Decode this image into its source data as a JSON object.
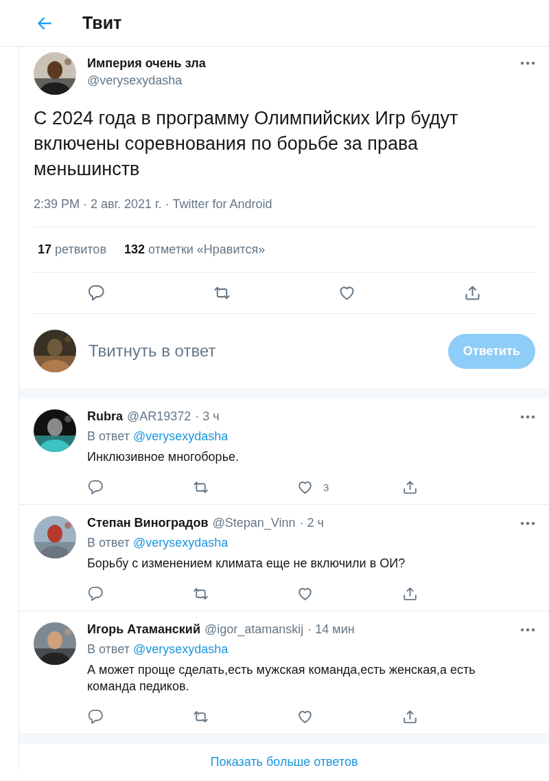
{
  "header": {
    "title": "Твит"
  },
  "tweet": {
    "author": {
      "name": "Империя очень зла",
      "handle": "@verysexydasha"
    },
    "text": "С 2024 года в программу Олимпийских Игр будут включены соревнования по борьбе за права меньшинств",
    "meta": "2:39 PM · 2 авг. 2021 г. · Twitter for Android",
    "stats": [
      {
        "count": "17",
        "label": "ретвитов"
      },
      {
        "count": "132",
        "label": "отметки «Нравится»"
      }
    ]
  },
  "compose": {
    "placeholder": "Твитнуть в ответ",
    "button": {
      "label": "Ответить",
      "disabled": true
    }
  },
  "replies": [
    {
      "name": "Rubra",
      "handle": "@AR19372",
      "time": "· 3 ч",
      "reply_label": "В ответ",
      "reply_to": "@verysexydasha",
      "text": "Инклюзивное многоборье.",
      "like_count": "3"
    },
    {
      "name": "Степан Виноградов",
      "handle": "@Stepan_Vinn",
      "time": "· 2 ч",
      "reply_label": "В ответ",
      "reply_to": "@verysexydasha",
      "text": "Борьбу с изменением климата еще не включили в ОИ?"
    },
    {
      "name": "Игорь Атаманский",
      "handle": "@igor_atamanskij",
      "time": "· 14 мин",
      "reply_label": "В ответ",
      "reply_to": "@verysexydasha",
      "text": "А может проще сделать,есть мужская команда,есть женская,а есть команда педиков."
    }
  ],
  "show_more": "Показать больше ответов"
}
